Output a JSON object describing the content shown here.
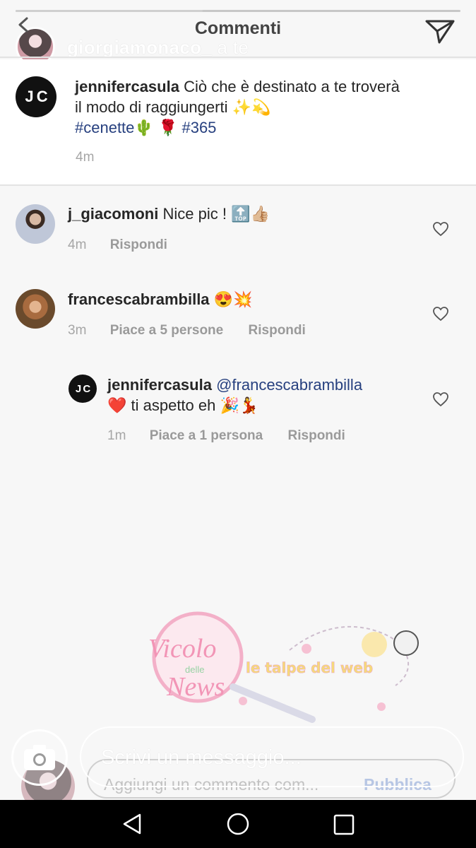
{
  "story": {
    "progress": 0.42,
    "title": "Commenti",
    "username": "giorgiamonaco_",
    "username_suffix": "a te"
  },
  "caption": {
    "username": "jennifercasula",
    "avatar_initials": "J C",
    "text": "Ciò che è destinato a te troverà il modo di raggiungerti ✨💫",
    "tags_line": [
      "#cenette",
      "🌵",
      "🌹",
      "#365"
    ],
    "time": "4m"
  },
  "comments": [
    {
      "username": "j_giacomoni",
      "text": "Nice pic ! 🔝👍🏼",
      "time": "4m",
      "likes": "",
      "reply": "Rispondi"
    },
    {
      "username": "francescabrambilla",
      "text": "😍💥",
      "time": "3m",
      "likes": "Piace a 5 persone",
      "reply": "Rispondi"
    }
  ],
  "reply": {
    "username": "jennifercasula",
    "avatar_initials": "J C",
    "mention": "@francescabrambilla",
    "text": "❤️ ti aspetto eh 🎉💃",
    "time": "1m",
    "likes": "Piace a 1 persona",
    "reply_label": "Rispondi"
  },
  "watermark": {
    "brand_1": "Vicolo delle News",
    "brand_2": "le talpe del web"
  },
  "input": {
    "message_placeholder": "Scrivi un messaggio...",
    "comment_placeholder": "Aggiungi un commento com...",
    "publish_label": "Pubblica"
  },
  "colors": {
    "hashtag": "#27407f",
    "meta": "#9a9a9a",
    "navbar": "#000000"
  }
}
